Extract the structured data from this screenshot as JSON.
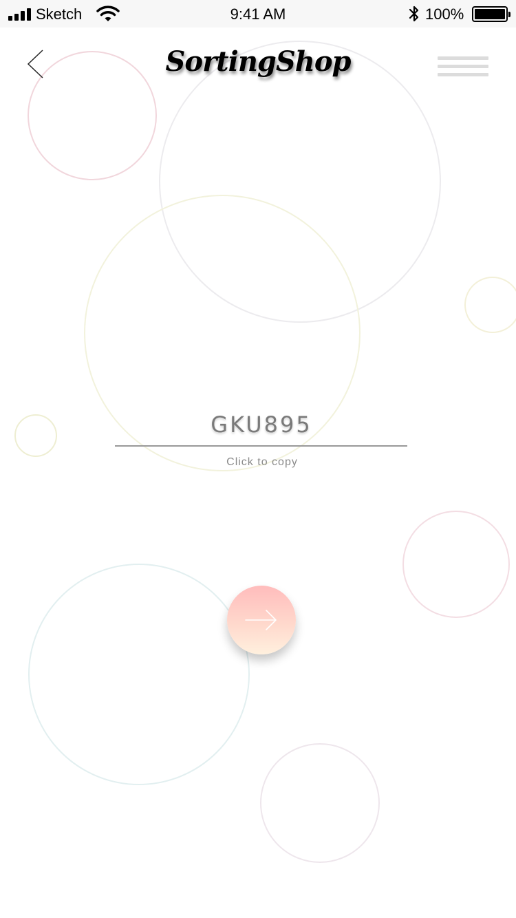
{
  "status_bar": {
    "carrier": "Sketch",
    "time": "9:41 AM",
    "battery": "100%",
    "icons": [
      "signal-icon",
      "wifi-icon",
      "bluetooth-icon",
      "battery-icon"
    ]
  },
  "nav": {
    "title": "SortingShop",
    "icons": [
      "back-chevron-icon",
      "hamburger-menu-icon"
    ]
  },
  "code_panel": {
    "code": "GKU895",
    "copy_hint": "Click to copy"
  },
  "next_button": {
    "icon": "arrow-right-icon",
    "gradient": [
      "#ffbcbc",
      "#fff0de"
    ]
  }
}
